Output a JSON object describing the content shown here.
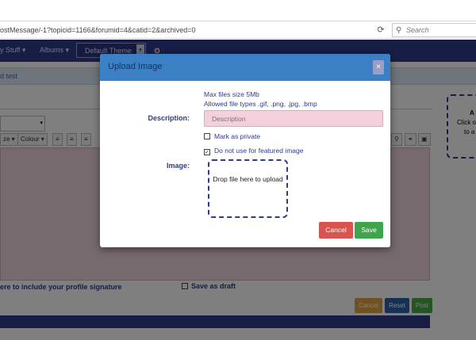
{
  "browser": {
    "url": "ostMessage/-1?topicid=1166&forumid=4&catid=2&archived=0",
    "search_placeholder": "Search"
  },
  "navbar": {
    "items": [
      "y Stuff ▾",
      "Albums ▾"
    ],
    "theme": "Default Theme"
  },
  "page": {
    "breadcrumb": "d test",
    "toolbar": [
      "ze ▾",
      "Colour ▾"
    ],
    "signature_text": "ere to include your profile signature",
    "draft_label": "Save as draft",
    "buttons": {
      "cancel": "Cancel",
      "reset": "Reset",
      "post": "Post"
    },
    "side_card": [
      "A",
      "Click o",
      "to a"
    ]
  },
  "modal": {
    "title": "Upload Image",
    "close": "×",
    "max_size": "Max files size 5Mb",
    "allowed_types": "Allowed file types .gif, .png, .jpg, .bmp",
    "description_label": "Description:",
    "description_placeholder": "Description",
    "private_label": "Mark as private",
    "private_checked": false,
    "featured_label": "Do not use for featured image",
    "featured_checked": true,
    "image_label": "Image:",
    "dropzone_text": "Drop file here to upload",
    "cancel": "Cancel",
    "save": "Save"
  },
  "colors": {
    "navbar": "#2e3a8a",
    "modal_header": "#3b7fc4",
    "cancel": "#d9534f",
    "save": "#3fa54a",
    "page_cancel": "#e0a243",
    "page_reset": "#2f62a8",
    "page_post": "#4da84a"
  }
}
